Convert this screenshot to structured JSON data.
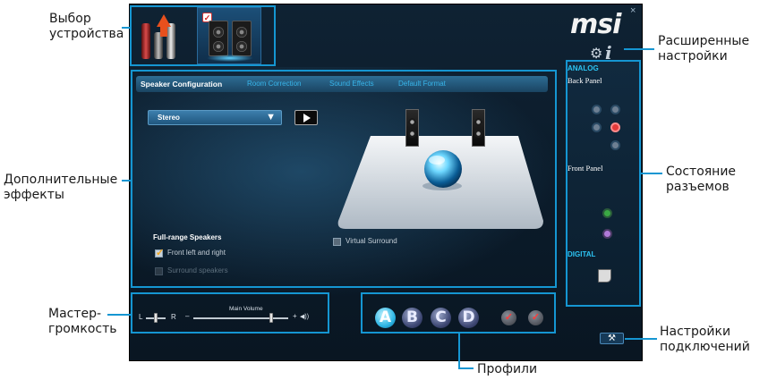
{
  "callouts": {
    "device_select": [
      "Выбор",
      "устройства"
    ],
    "extra_effects": [
      "Дополнительные",
      "эффекты"
    ],
    "master_volume": [
      "Мастер-",
      "громкость"
    ],
    "profiles": "Профили",
    "advanced_settings": [
      "Расширенные",
      "настройки"
    ],
    "jack_status": [
      "Состояние",
      "разъемов"
    ],
    "connection_settings": [
      "Настройки",
      "подключений"
    ]
  },
  "app": {
    "logo": "msi",
    "close_icon": "×",
    "tabs": [
      "Speaker Configuration",
      "Room Correction",
      "Sound Effects",
      "Default Format"
    ],
    "active_tab": "Speaker Configuration",
    "speaker_config": {
      "selected": "Stereo",
      "caret": "▼"
    },
    "virtual_surround": {
      "label": "Virtual Surround",
      "checked": false
    },
    "full_range": {
      "title": "Full-range Speakers",
      "front": {
        "label": "Front left and right",
        "checked": true
      },
      "surround": {
        "label": "Surround speakers",
        "checked": false,
        "enabled": false
      }
    },
    "volume": {
      "title": "Main Volume",
      "left": "L",
      "right": "R",
      "minus": "–",
      "plus": "+",
      "speaker_icon": "◀))",
      "balance_position": 0.5,
      "level": 0.82
    },
    "profiles": [
      "A",
      "B",
      "C",
      "D"
    ],
    "active_profile": "A",
    "connector_panel": {
      "analog_label": "ANALOG",
      "back_panel_label": "Back Panel",
      "front_panel_label": "Front Panel",
      "digital_label": "DIGITAL"
    },
    "colors": {
      "accent": "#1596d2",
      "tab_text": "#38b5ea",
      "analog_heading": "#2cc3f2",
      "digital_heading": "#2cc3f2"
    },
    "icons": {
      "wrench": "wrench-icon",
      "gear": "gear-icon",
      "info": "info-icon"
    }
  }
}
